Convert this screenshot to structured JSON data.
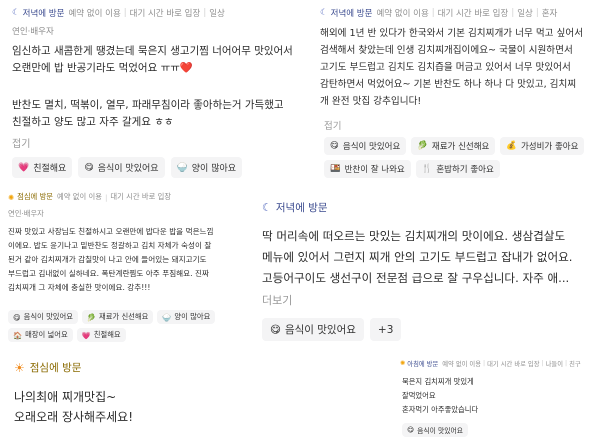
{
  "card1": {
    "visit": "저녁에 방문",
    "meta": [
      "예약 없이 이용",
      "대기 시간 바로 입장",
      "일상"
    ],
    "sub": "연인·배우자",
    "lines": [
      "임신하고 새콤한게 땡겼는데 묵은지 생고기찜 너어어무 맛있어서",
      "오랜만에 밥 반공기라도 먹었어요 ㅠㅠ❤️",
      "",
      "반찬도 멸치, 떡볶이, 열무, 파래무침이라 좋아하는거 가득했고",
      "친절하고 양도 많고 자주 갈게요 ㅎㅎ"
    ],
    "more": "접기",
    "tags": [
      {
        "icon": "💗",
        "label": "친절해요"
      },
      {
        "icon": "😋",
        "label": "음식이 맛있어요"
      },
      {
        "icon": "🍚",
        "label": "양이 많아요"
      }
    ]
  },
  "card2": {
    "visit": "저녁에 방문",
    "meta": [
      "예약 없이 이용",
      "대기 시간 바로 입장",
      "일상",
      "혼자"
    ],
    "lines": [
      "해외에 1년 반 있다가 한국와서 기본 김치찌개가 너무 먹고 싶어서",
      "검색해서 찾았는데 인생 김치찌개집이에요~ 국물이 시원하면서",
      "고기도 부드럽고 김치도 김치즙을 머금고 있어서 너무 맛있어서",
      "감탄하면서 먹었어요~ 기본 반찬도 하나 하나 다 맛있고, 김치찌",
      "개 완전 맛집 강추입니다!"
    ],
    "more": "접기",
    "tags": [
      {
        "icon": "😋",
        "label": "음식이 맛있어요"
      },
      {
        "icon": "🥬",
        "label": "재료가 신선해요"
      },
      {
        "icon": "💰",
        "label": "가성비가 좋아요"
      },
      {
        "icon": "🍱",
        "label": "반찬이 잘 나와요"
      },
      {
        "icon": "🍴",
        "label": "혼밥하기 좋아요"
      }
    ]
  },
  "card3": {
    "visit": "점심에 방문",
    "meta": [
      "예약 없이 이용",
      "대기 시간 바로 입장"
    ],
    "sub": "연인·배우자",
    "lines": [
      "진짜 맛있고 사장님도 친절하시고 오랜만에 밥다운 밥을 먹은느낌",
      "이에요. 밥도 윤기나고 밑반찬도 정갈하고 김치 자체가 숙성이 잘",
      "된거 같아 김치찌개가 감칠맛이 나고 안에 들어있는 돼지고기도",
      "부드럽고 김내없이 실하네요. 폭탄계란찜도 아주 푸짐해요. 진짜",
      "김치찌개 그 자체에 충실한 맛이에요. 강추!!!"
    ],
    "tags": [
      {
        "icon": "😋",
        "label": "음식이 맛있어요"
      },
      {
        "icon": "🥬",
        "label": "재료가 신선해요"
      },
      {
        "icon": "🍚",
        "label": "양이 많아요"
      },
      {
        "icon": "🏠",
        "label": "매장이 넓어요"
      },
      {
        "icon": "💗",
        "label": "친절해요"
      }
    ]
  },
  "card4": {
    "visit": "저녁에 방문",
    "lines": [
      "딱 머리속에 떠오르는 맛있는 김치찌개의 맛이에요. 생삼겹살도",
      "메뉴에 있어서 그런지 찌개 안의 고기도 부드럽고 잡내가 없어요.",
      "고등어구이도 생선구이 전문점 급으로 잘 구우십니다. 자주 애..."
    ],
    "more": "더보기",
    "tags": [
      {
        "icon": "😋",
        "label": "음식이 맛있어요"
      },
      {
        "icon": "",
        "label": "+3"
      }
    ]
  },
  "card5": {
    "visit": "점심에 방문",
    "lines": [
      "나의최애 찌개맛집~",
      "오래오래 장사해주세요!"
    ]
  },
  "card6": {
    "visit": "아침에 방문",
    "meta": [
      "예약 없이 이용",
      "대기 시간 바로 입장",
      "나들이",
      "친구"
    ],
    "lines": [
      "묵은지 김치찌개 맛있게",
      "잘먹었어요",
      "혼자먹기 아주좋았습니다"
    ],
    "tags": [
      {
        "icon": "😋",
        "label": "음식이 맛있어요"
      }
    ]
  }
}
